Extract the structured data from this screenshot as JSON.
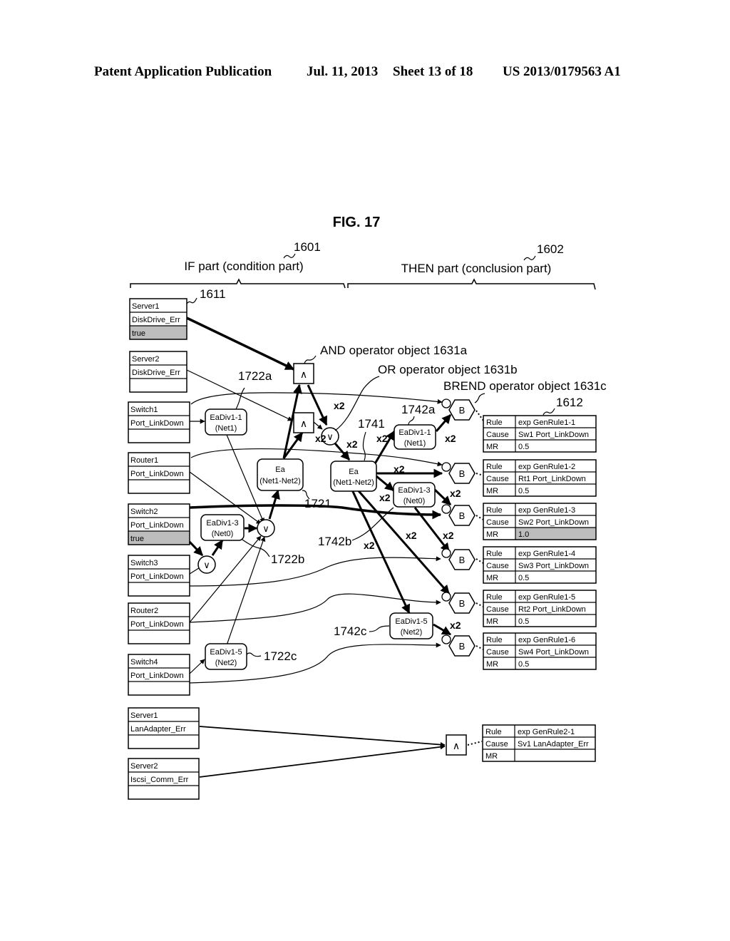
{
  "header": {
    "publication": "Patent Application Publication",
    "date": "Jul. 11, 2013",
    "sheet": "Sheet 13 of 18",
    "number": "US 2013/0179563 A1"
  },
  "figure": {
    "title": "FIG. 17",
    "if_part": {
      "label": "IF part (condition part)",
      "ref": "1601"
    },
    "then_part": {
      "label": "THEN part (conclusion part)",
      "ref": "1602"
    },
    "refs": {
      "r1611": "1611",
      "r1612": "1612",
      "r1721": "1721",
      "r1722a": "1722a",
      "r1722b": "1722b",
      "r1722c": "1722c",
      "r1741": "1741",
      "r1742a": "1742a",
      "r1742b": "1742b",
      "r1742c": "1742c"
    },
    "annotations": {
      "and_op": "AND operator object 1631a",
      "or_op": "OR operator object 1631b",
      "brend_op": "BREND operator object 1631c"
    },
    "multiplier": "x2",
    "ops": {
      "and": "∧",
      "or": "∨",
      "brend": "B"
    },
    "conditions": [
      {
        "device": "Server1",
        "event": "DiskDrive_Err",
        "value": "true",
        "shaded": true
      },
      {
        "device": "Server2",
        "event": "DiskDrive_Err",
        "value": "",
        "shaded": false
      },
      {
        "device": "Switch1",
        "event": "Port_LinkDown",
        "value": "",
        "shaded": false
      },
      {
        "device": "Router1",
        "event": "Port_LinkDown",
        "value": "",
        "shaded": false
      },
      {
        "device": "Switch2",
        "event": "Port_LinkDown",
        "value": "true",
        "shaded": true
      },
      {
        "device": "Switch3",
        "event": "Port_LinkDown",
        "value": "",
        "shaded": false
      },
      {
        "device": "Router2",
        "event": "Port_LinkDown",
        "value": "",
        "shaded": false
      },
      {
        "device": "Switch4",
        "event": "Port_LinkDown",
        "value": "",
        "shaded": false
      },
      {
        "device": "Server1",
        "event": "LanAdapter_Err",
        "value": "",
        "shaded": false
      },
      {
        "device": "Server2",
        "event": "Iscsi_Comm_Err",
        "value": "",
        "shaded": false
      }
    ],
    "nodes": {
      "eadiv11_left": [
        "EaDiv1-1",
        "(Net1)"
      ],
      "eadiv13_left": [
        "EaDiv1-3",
        "(Net0)"
      ],
      "eadiv15_left": [
        "EaDiv1-5",
        "(Net2)"
      ],
      "ea_left": [
        "Ea",
        "(Net1-Net2)"
      ],
      "ea_right": [
        "Ea",
        "(Net1-Net2)"
      ],
      "eadiv11_right": [
        "EaDiv1-1",
        "(Net1)"
      ],
      "eadiv13_right": [
        "EaDiv1-3",
        "(Net0)"
      ],
      "eadiv15_right": [
        "EaDiv1-5",
        "(Net2)"
      ]
    },
    "conclusions": [
      {
        "rule_label": "Rule",
        "rule": "exp GenRule1-1",
        "cause_label": "Cause",
        "cause": "Sw1 Port_LinkDown",
        "mr_label": "MR",
        "mr": "0.5",
        "shaded": false
      },
      {
        "rule_label": "Rule",
        "rule": "exp GenRule1-2",
        "cause_label": "Cause",
        "cause": "Rt1 Port_LinkDown",
        "mr_label": "MR",
        "mr": "0.5",
        "shaded": false
      },
      {
        "rule_label": "Rule",
        "rule": "exp GenRule1-3",
        "cause_label": "Cause",
        "cause": "Sw2 Port_LinkDown",
        "mr_label": "MR",
        "mr": "1.0",
        "shaded": true
      },
      {
        "rule_label": "Rule",
        "rule": "exp GenRule1-4",
        "cause_label": "Cause",
        "cause": "Sw3 Port_LinkDown",
        "mr_label": "MR",
        "mr": "0.5",
        "shaded": false
      },
      {
        "rule_label": "Rule",
        "rule": "exp GenRule1-5",
        "cause_label": "Cause",
        "cause": "Rt2 Port_LinkDown",
        "mr_label": "MR",
        "mr": "0.5",
        "shaded": false
      },
      {
        "rule_label": "Rule",
        "rule": "exp GenRule1-6",
        "cause_label": "Cause",
        "cause": "Sw4 Port_LinkDown",
        "mr_label": "MR",
        "mr": "0.5",
        "shaded": false
      },
      {
        "rule_label": "Rule",
        "rule": "exp GenRule2-1",
        "cause_label": "Cause",
        "cause": "Sv1 LanAdapter_Err",
        "mr_label": "MR",
        "mr": "",
        "shaded": false
      }
    ]
  }
}
